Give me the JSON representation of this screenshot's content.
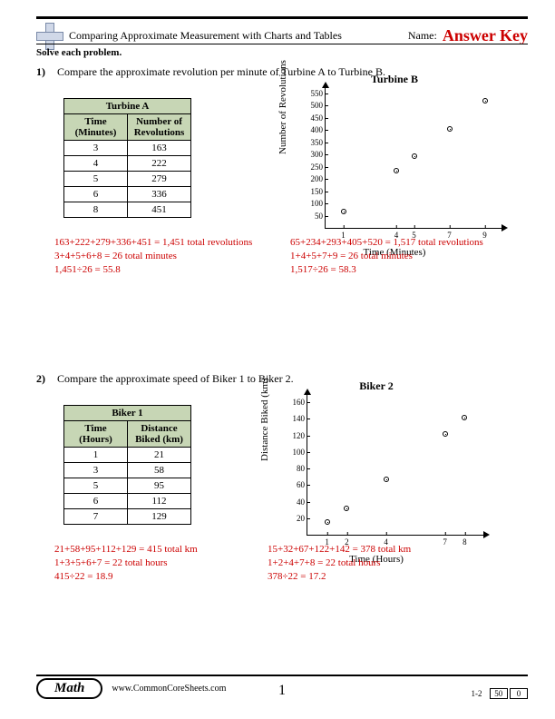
{
  "header": {
    "title": "Comparing Approximate Measurement with Charts and Tables",
    "name_label": "Name:",
    "answer_key": "Answer Key"
  },
  "instruction": "Solve each problem.",
  "problems": [
    {
      "num": "1)",
      "text": "Compare the approximate revolution per minute of Turbine A to Turbine B.",
      "table": {
        "title": "Turbine A",
        "col1": "Time (Minutes)",
        "col2": "Number of Revolutions",
        "rows": [
          {
            "a": "3",
            "b": "163"
          },
          {
            "a": "4",
            "b": "222"
          },
          {
            "a": "5",
            "b": "279"
          },
          {
            "a": "6",
            "b": "336"
          },
          {
            "a": "8",
            "b": "451"
          }
        ]
      },
      "calc_left": [
        "163+222+279+336+451 = 1,451 total revolutions",
        "3+4+5+6+8 = 26 total minutes",
        "1,451÷26 = 55.8"
      ],
      "calc_right": [
        "65+234+293+405+520 = 1,517 total revolutions",
        "1+4+5+7+9 = 26 total minutes",
        "1,517÷26 = 58.3"
      ]
    },
    {
      "num": "2)",
      "text": "Compare the approximate speed of Biker 1 to Biker 2.",
      "table": {
        "title": "Biker 1",
        "col1": "Time (Hours)",
        "col2": "Distance Biked (km)",
        "rows": [
          {
            "a": "1",
            "b": "21"
          },
          {
            "a": "3",
            "b": "58"
          },
          {
            "a": "5",
            "b": "95"
          },
          {
            "a": "6",
            "b": "112"
          },
          {
            "a": "7",
            "b": "129"
          }
        ]
      },
      "calc_left": [
        "21+58+95+112+129 = 415 total km",
        "1+3+5+6+7 = 22 total hours",
        "415÷22 = 18.9"
      ],
      "calc_right": [
        "15+32+67+122+142 = 378 total km",
        "1+2+4+7+8 = 22 total hours",
        "378÷22 = 17.2"
      ]
    }
  ],
  "chart_data": [
    {
      "type": "scatter",
      "title": "Turbine B",
      "xlabel": "Time (Minutes)",
      "ylabel": "Number of Revolutions",
      "x": [
        1,
        4,
        5,
        7,
        9
      ],
      "y": [
        65,
        234,
        293,
        405,
        520
      ],
      "xticks": [
        1,
        4,
        5,
        7,
        9
      ],
      "yticks": [
        50,
        100,
        150,
        200,
        250,
        300,
        350,
        400,
        450,
        500,
        550
      ],
      "xlim": [
        0,
        10
      ],
      "ylim": [
        0,
        575
      ]
    },
    {
      "type": "scatter",
      "title": "Biker 2",
      "xlabel": "Time (Hours)",
      "ylabel": "Distance Biked (km)",
      "x": [
        1,
        2,
        4,
        7,
        8
      ],
      "y": [
        15,
        32,
        67,
        122,
        142
      ],
      "xticks": [
        1,
        2,
        4,
        7,
        8
      ],
      "yticks": [
        20,
        40,
        60,
        80,
        100,
        120,
        140,
        160
      ],
      "xlim": [
        0,
        9
      ],
      "ylim": [
        0,
        170
      ]
    }
  ],
  "footer": {
    "subject": "Math",
    "site": "www.CommonCoreSheets.com",
    "page": "1",
    "score_label": "1-2",
    "score1": "50",
    "score2": "0"
  }
}
